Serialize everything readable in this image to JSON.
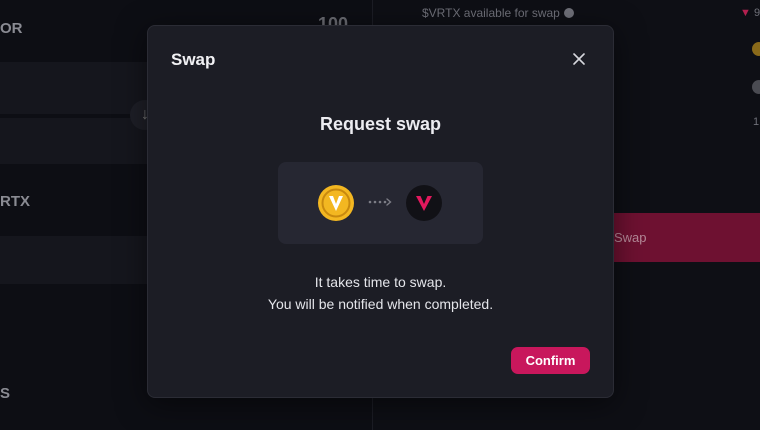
{
  "background": {
    "left_label_top": "OR",
    "left_label_mid": "RTX",
    "left_label_bottom": "S",
    "amount": "100",
    "available_text": "$VRTX available for swap",
    "swap_button_label": "Swap",
    "edge_text_1": "9",
    "edge_text_2": "1"
  },
  "modal": {
    "title": "Swap",
    "subtitle": "Request swap",
    "from_token_icon": "vertex-gold-coin-icon",
    "to_token_icon": "vertex-red-logo-icon",
    "message_line1": "It takes time to swap.",
    "message_line2": "You will be notified when completed.",
    "confirm_label": "Confirm",
    "close_icon": "close-icon"
  },
  "colors": {
    "accent": "#c8175c",
    "modal_bg": "#1c1d25",
    "gold": "#f3b721",
    "vertex_red": "#e2185d"
  }
}
